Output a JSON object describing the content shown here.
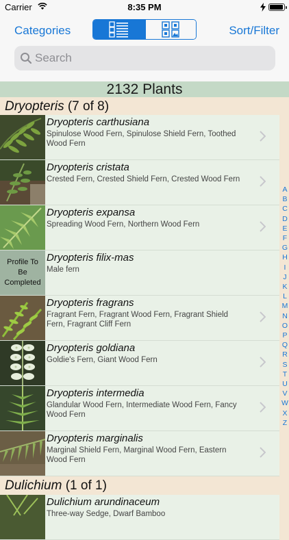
{
  "status_bar": {
    "carrier": "Carrier",
    "time": "8:35 PM"
  },
  "nav": {
    "categories_label": "Categories",
    "sort_filter_label": "Sort/Filter",
    "segments": [
      {
        "icon": "list-view-icon",
        "selected": true
      },
      {
        "icon": "grid-view-icon",
        "selected": false
      }
    ]
  },
  "search": {
    "placeholder": "Search"
  },
  "count": "2132 Plants",
  "sections": [
    {
      "genus": "Dryopteris",
      "count_label": "(7 of 8)",
      "rows": [
        {
          "sci": "Dryopteris carthusiana",
          "common": "Spinulose Wood Fern, Spinulose Shield Fern, Toothed Wood Fern",
          "thumb": "photo"
        },
        {
          "sci": "Dryopteris cristata",
          "common": "Crested Fern, Crested Shield Fern, Crested Wood Fern",
          "thumb": "photo"
        },
        {
          "sci": "Dryopteris expansa",
          "common": "Spreading Wood Fern, Northern Wood Fern",
          "thumb": "photo"
        },
        {
          "sci": "Dryopteris filix-mas",
          "common": "Male fern",
          "thumb": "placeholder",
          "placeholder_text": "Profile To Be Completed"
        },
        {
          "sci": "Dryopteris fragrans",
          "common": "Fragrant Fern, Fragrant Wood Fern, Fragrant Shield Fern, Fragrant Cliff Fern",
          "thumb": "photo"
        },
        {
          "sci": "Dryopteris goldiana",
          "common": "Goldie's Fern, Giant Wood Fern",
          "thumb": "photo"
        },
        {
          "sci": "Dryopteris intermedia",
          "common": "Glandular Wood Fern, Intermediate Wood Fern, Fancy Wood Fern",
          "thumb": "photo"
        },
        {
          "sci": "Dryopteris marginalis",
          "common": "Marginal Shield Fern, Marginal Wood Fern, Eastern Wood Fern",
          "thumb": "photo"
        }
      ]
    },
    {
      "genus": "Dulichium",
      "count_label": "(1 of 1)",
      "rows": [
        {
          "sci": "Dulichium arundinaceum",
          "common": "Three-way Sedge, Dwarf Bamboo",
          "thumb": "photo"
        }
      ]
    }
  ],
  "index_letters": [
    "A",
    "B",
    "C",
    "D",
    "E",
    "F",
    "G",
    "H",
    "I",
    "J",
    "K",
    "L",
    "M",
    "N",
    "O",
    "P",
    "Q",
    "R",
    "S",
    "T",
    "U",
    "V",
    "W",
    "X",
    "Z"
  ],
  "colors": {
    "accent": "#1877d6",
    "row_bg": "#e9f1e7",
    "section_bg": "#f3e6d4",
    "count_bg": "#c4d9c6"
  }
}
